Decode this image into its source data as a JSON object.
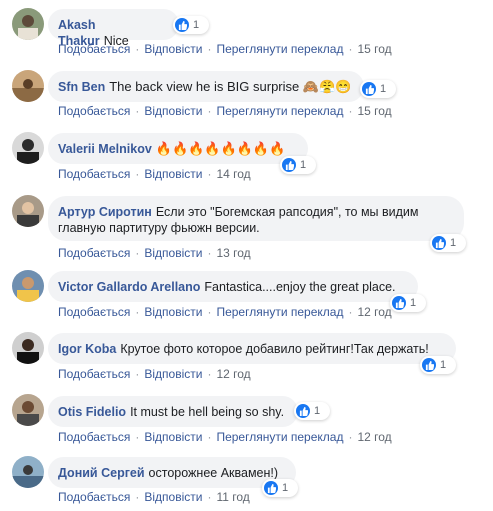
{
  "actions": {
    "like": "Подобається",
    "reply": "Відповісти",
    "translate": "Переглянути переклад",
    "separator": "·"
  },
  "colors": {
    "author": "#385898",
    "bubble": "#f2f3f5",
    "like_badge": "#1877f2",
    "meta": "#606770"
  },
  "comments": [
    {
      "author": "Akash Thakur",
      "text": "Nice",
      "reactions": "1",
      "time": "15 год",
      "has_translate": true
    },
    {
      "author": "Sfn Ben",
      "text": "The back view he is BIG surprise 🙈😤😁",
      "reactions": "1",
      "time": "15 год",
      "has_translate": true
    },
    {
      "author": "Valerii Melnikov",
      "text": "🔥🔥🔥🔥🔥🔥🔥🔥",
      "reactions": "1",
      "time": "14 год",
      "has_translate": false
    },
    {
      "author": "Артур Сиротин",
      "text": "Если это \"Богемская рапсодия\", то мы видим",
      "text2": "главную партитуру фьюжн версии.",
      "reactions": "1",
      "time": "13 год",
      "has_translate": false
    },
    {
      "author": "Victor Gallardo Arellano",
      "text": "Fantastica....enjoy the great place.",
      "reactions": "1",
      "time": "12 год",
      "has_translate": true
    },
    {
      "author": "Igor Koba",
      "text": "Крутое фото которое добавило рейтинг!Так держать!",
      "reactions": "1",
      "time": "12 год",
      "has_translate": false
    },
    {
      "author": "Otis Fidelio",
      "text": "It must be hell being so shy.",
      "reactions": "1",
      "time": "12 год",
      "has_translate": true
    },
    {
      "author": "Доний Сергей",
      "text": "осторожнее Аквамен!)",
      "reactions": "1",
      "time": "11 год",
      "has_translate": false
    }
  ]
}
